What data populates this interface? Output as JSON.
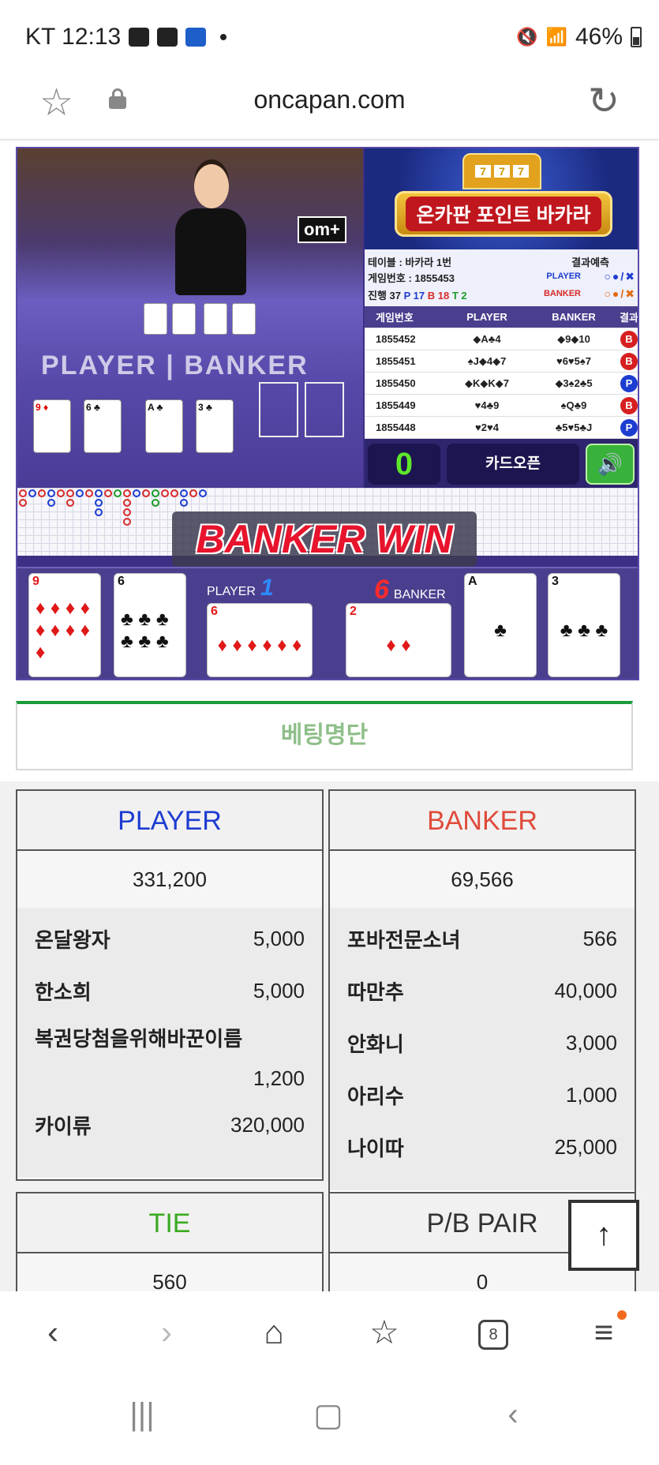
{
  "status_bar": {
    "carrier_time": "KT 12:13",
    "battery": "46%"
  },
  "url_bar": {
    "url": "oncapan.com"
  },
  "game": {
    "watermark": "om+",
    "table_text": "PLAYER | BANKER",
    "banner_title": "온카판 포인트 바카라",
    "info": {
      "table": "테이블 : 바카라 1번",
      "game_no": "게임번호 : 1855453",
      "progress_label": "진행 37",
      "p": "P 17",
      "b": "B 18",
      "t": "T 2",
      "prediction": "결과예측",
      "player": "PLAYER",
      "banker": "BANKER"
    },
    "history_headers": [
      "게임번호",
      "PLAYER",
      "BANKER",
      "결과"
    ],
    "history": [
      {
        "no": "1855452",
        "player": "◆A♣4",
        "banker": "◆9◆10",
        "result": "B"
      },
      {
        "no": "1855451",
        "player": "♠J◆4◆7",
        "banker": "♥6♥5♠7",
        "result": "B"
      },
      {
        "no": "1855450",
        "player": "◆K◆K◆7",
        "banker": "◆3♠2♣5",
        "result": "P"
      },
      {
        "no": "1855449",
        "player": "♥4♣9",
        "banker": "♠Q♣9",
        "result": "B"
      },
      {
        "no": "1855448",
        "player": "♥2♥4",
        "banker": "♣5♥5♣J",
        "result": "P"
      }
    ],
    "counter": "0",
    "card_open": "카드오픈",
    "win_text": "BANKER WIN",
    "player_label": "PLAYER",
    "player_score": "1",
    "banker_label": "BANKER",
    "banker_score": "6",
    "result_cards": [
      {
        "rank": "9",
        "suit": "♦",
        "color": "red"
      },
      {
        "rank": "6",
        "suit": "♣",
        "color": "black"
      },
      {
        "rank": "6",
        "suit": "♦",
        "color": "red"
      },
      {
        "rank": "2",
        "suit": "♦",
        "color": "red"
      },
      {
        "rank": "A",
        "suit": "♣",
        "color": "black"
      },
      {
        "rank": "3",
        "suit": "♣",
        "color": "black"
      }
    ]
  },
  "bet_list": {
    "title": "베팅명단",
    "player": {
      "title": "PLAYER",
      "color": "#1d3cd0",
      "total": "331,200",
      "rows": [
        {
          "name": "온달왕자",
          "amount": "5,000"
        },
        {
          "name": "한소희",
          "amount": "5,000"
        },
        {
          "name": "복권당첨을위해바꾼이름",
          "amount": "1,200"
        },
        {
          "name": "카이류",
          "amount": "320,000"
        }
      ]
    },
    "banker": {
      "title": "BANKER",
      "color": "#e04a3a",
      "total": "69,566",
      "rows": [
        {
          "name": "포바전문소녀",
          "amount": "566"
        },
        {
          "name": "따만추",
          "amount": "40,000"
        },
        {
          "name": "안화니",
          "amount": "3,000"
        },
        {
          "name": "아리수",
          "amount": "1,000"
        },
        {
          "name": "나이따",
          "amount": "25,000"
        }
      ]
    },
    "tie": {
      "title": "TIE",
      "color": "#3aaa20",
      "total": "560"
    },
    "pair": {
      "title": "P/B PAIR",
      "color": "#333333",
      "total": "0"
    }
  },
  "bottom_nav": {
    "tabs_count": "8"
  }
}
